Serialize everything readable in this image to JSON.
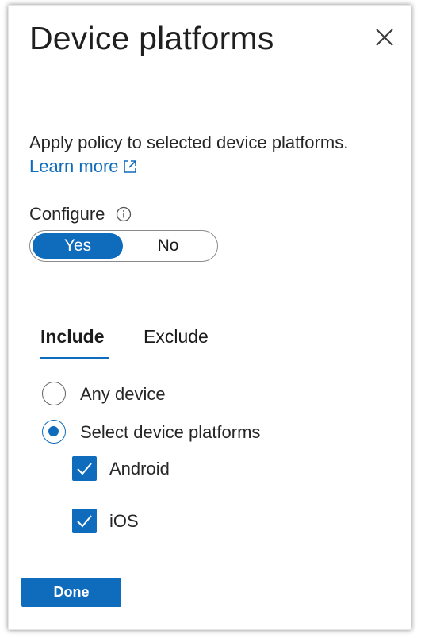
{
  "panel": {
    "title": "Device platforms",
    "close_icon": "close-icon",
    "description": "Apply policy to selected device platforms.",
    "learn_more": "Learn more",
    "external_link_icon": "external-link-icon"
  },
  "configure": {
    "label": "Configure",
    "info_icon": "info-icon",
    "options": [
      "Yes",
      "No"
    ],
    "selected": "Yes"
  },
  "tabs": [
    {
      "label": "Include",
      "active": true
    },
    {
      "label": "Exclude",
      "active": false
    }
  ],
  "radio_options": [
    {
      "label": "Any device",
      "selected": false
    },
    {
      "label": "Select device platforms",
      "selected": true
    }
  ],
  "platforms": [
    {
      "label": "Android",
      "checked": true
    },
    {
      "label": "iOS",
      "checked": true
    }
  ],
  "footer": {
    "done_label": "Done"
  },
  "colors": {
    "accent": "#0f6cbd",
    "text": "#1b1b1b"
  }
}
